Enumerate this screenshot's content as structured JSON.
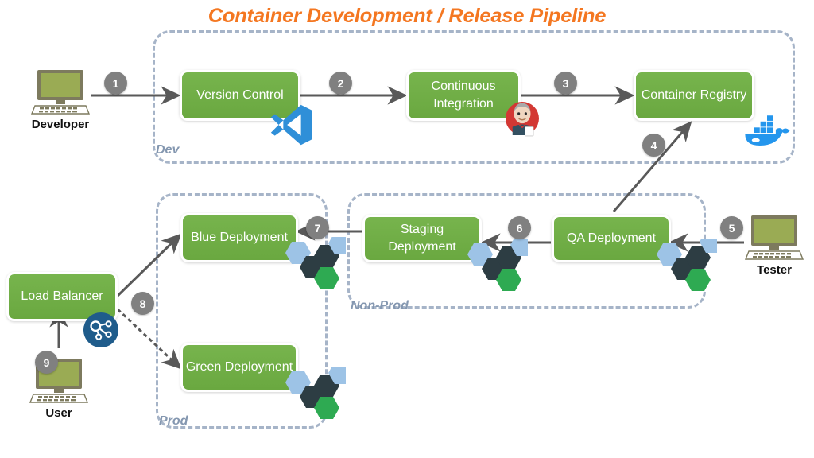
{
  "title": "Container Development / Release Pipeline",
  "colors": {
    "title": "#f47721",
    "box_green": "#70ad47",
    "zone_border": "#a6b4c8",
    "zone_label": "#8497b0",
    "badge_gray": "#808080",
    "arrow_gray": "#595959",
    "hex_blue": "#9dc3e6",
    "hex_dark": "#2d3d43",
    "hex_green": "#2eaa52",
    "docker_blue": "#2496ed",
    "vscode_blue": "#2f8fd8",
    "loadbalancer_blue": "#1f5c8b",
    "screen_green": "#9aab54"
  },
  "zones": [
    {
      "name": "dev",
      "label": "Dev"
    },
    {
      "name": "non-prod",
      "label": "Non-Prod"
    },
    {
      "name": "prod",
      "label": "Prod"
    }
  ],
  "boxes": [
    {
      "name": "version-control",
      "label": "Version Control",
      "icon": "vscode-icon"
    },
    {
      "name": "continuous-integration",
      "label": "Continuous Integration",
      "icon": "jenkins-icon"
    },
    {
      "name": "container-registry",
      "label": "Container Registry",
      "icon": "docker-icon"
    },
    {
      "name": "qa-deployment",
      "label": "QA Deployment",
      "icon": "hexagon-cluster-icon"
    },
    {
      "name": "staging-deployment",
      "label": "Staging Deployment",
      "icon": "hexagon-cluster-icon"
    },
    {
      "name": "blue-deployment",
      "label": "Blue Deployment",
      "icon": "hexagon-cluster-icon"
    },
    {
      "name": "green-deployment",
      "label": "Green Deployment",
      "icon": "hexagon-cluster-icon"
    },
    {
      "name": "load-balancer",
      "label": "Load Balancer",
      "icon": "load-balancer-icon"
    }
  ],
  "actors": [
    {
      "name": "developer",
      "label": "Developer",
      "icon": "computer-icon"
    },
    {
      "name": "tester",
      "label": "Tester",
      "icon": "computer-icon"
    },
    {
      "name": "user",
      "label": "User",
      "icon": "computer-icon"
    }
  ],
  "steps": [
    {
      "n": "1",
      "from": "developer",
      "to": "version-control"
    },
    {
      "n": "2",
      "from": "version-control",
      "to": "continuous-integration"
    },
    {
      "n": "3",
      "from": "continuous-integration",
      "to": "container-registry"
    },
    {
      "n": "4",
      "from": "qa-deployment",
      "to": "container-registry"
    },
    {
      "n": "5",
      "from": "tester",
      "to": "qa-deployment"
    },
    {
      "n": "6",
      "from": "qa-deployment",
      "to": "staging-deployment"
    },
    {
      "n": "7",
      "from": "staging-deployment",
      "to": "blue-deployment"
    },
    {
      "n": "8",
      "from": "load-balancer",
      "to": "blue-deployment / green-deployment"
    },
    {
      "n": "9",
      "from": "user",
      "to": "load-balancer"
    }
  ]
}
